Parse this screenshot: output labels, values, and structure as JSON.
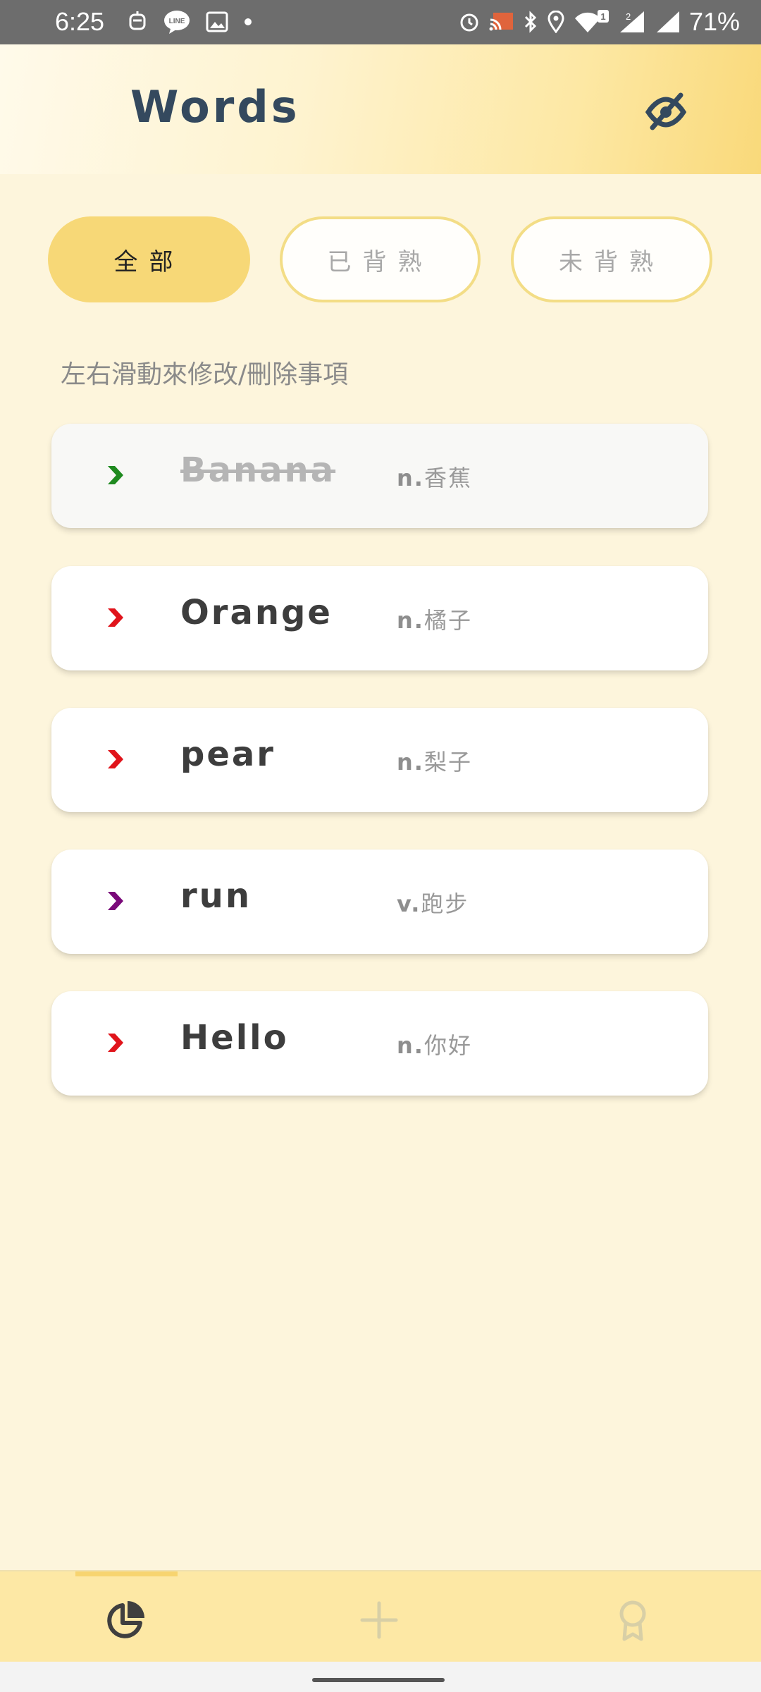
{
  "status_bar": {
    "time": "6:25",
    "left_icons": [
      "robot-icon",
      "line-app-icon",
      "image-icon",
      "dot-icon"
    ],
    "right_icons": [
      "alarm-icon",
      "cast-icon",
      "bluetooth-icon",
      "location-icon",
      "wifi-icon",
      "signal-icon",
      "signal-icon"
    ],
    "battery": "71%"
  },
  "header": {
    "title": "Words",
    "visibility_icon": "eye-off-icon"
  },
  "filters": {
    "all": "全部",
    "learned": "已背熟",
    "unlearned": "未背熟",
    "active": "all"
  },
  "hint": "左右滑動來修改/刪除事項",
  "words": [
    {
      "word": "Banana",
      "pos": "n.",
      "meaning": "香蕉",
      "arrow_color": "#1f8a1f",
      "learned": true
    },
    {
      "word": "Orange",
      "pos": "n.",
      "meaning": "橘子",
      "arrow_color": "#e0141b",
      "learned": false
    },
    {
      "word": "pear",
      "pos": "n.",
      "meaning": "梨子",
      "arrow_color": "#e0141b",
      "learned": false
    },
    {
      "word": "run",
      "pos": "v.",
      "meaning": "跑步",
      "arrow_color": "#7a0a7a",
      "learned": false
    },
    {
      "word": "Hello",
      "pos": "n.",
      "meaning": "你好",
      "arrow_color": "#e0141b",
      "learned": false
    }
  ],
  "bottom_nav": {
    "items": [
      "pie-chart-icon",
      "plus-icon",
      "award-icon"
    ],
    "active": "pie-chart-icon"
  },
  "colors": {
    "accent": "#f7d877",
    "background": "#fdf5dc",
    "title": "#34495e"
  }
}
